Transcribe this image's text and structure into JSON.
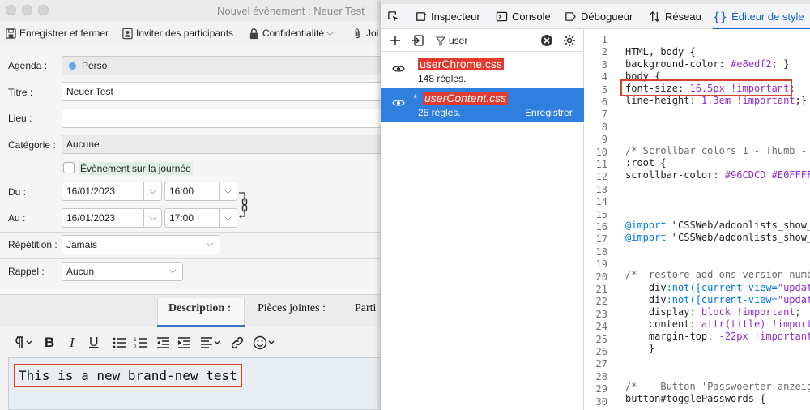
{
  "event_window": {
    "title": "Nouvel évènement : Neuer Test",
    "toolbar": {
      "save_close": "Enregistrer et fermer",
      "invite": "Inviter des participants",
      "privacy": "Confidentialité",
      "attach": "Joi"
    },
    "form": {
      "calendar_label": "Agenda :",
      "calendar_value": "Perso",
      "calendar_color": "#5fa8e8",
      "title_label": "Titre :",
      "title_value": "Neuer Test",
      "location_label": "Lieu :",
      "location_value": "",
      "category_label": "Catégorie :",
      "category_value": "Aucune",
      "allday_label": "Évènement sur la journée",
      "from_label": "Du :",
      "from_date": "16/01/2023",
      "from_time": "16:00",
      "to_label": "Au :",
      "to_date": "16/01/2023",
      "to_time": "17:00",
      "repeat_label": "Répétition :",
      "repeat_value": "Jamais",
      "reminder_label": "Rappel :",
      "reminder_value": "Aucun"
    },
    "tabs": {
      "description": "Description :",
      "attachments": "Pièces jointes :",
      "participants": "Parti"
    },
    "editor": {
      "text": "This is a new brand-new test"
    }
  },
  "devtools": {
    "tabs": {
      "inspector": "Inspecteur",
      "console": "Console",
      "debugger": "Débogueur",
      "network": "Réseau",
      "style_editor": "Éditeur de style"
    },
    "filter_value": "user",
    "sheets": [
      {
        "name": "userChrome.css",
        "rules": "148 règles."
      },
      {
        "name": "userContent.css",
        "rules": "25 règles.",
        "modified": "*",
        "save": "Enregistrer"
      }
    ],
    "code": {
      "line_numbers": [
        "1",
        "2",
        "3",
        "4",
        "5",
        "6",
        "7",
        "8",
        "9",
        "10",
        "11",
        "12",
        "13",
        "14",
        "15",
        "16",
        "17",
        "18",
        "19",
        "20",
        "21",
        "22",
        "23",
        "24",
        "25",
        "26",
        "27",
        "28",
        "29",
        "30"
      ],
      "l2_sel": "HTML, body {",
      "l3_prop": "background-color: ",
      "l3_val": "#e8edf2",
      "l3_end": "; }",
      "l4": "body {",
      "l5_prop": "font-size: ",
      "l5_val": "16.5px !important",
      "l5_end": ";",
      "l6_prop": "line-height: ",
      "l6_val": "1.3em !important",
      "l6_end": ";}",
      "l10": "/* Scrollbar colors 1 - Thumb - 2",
      "l11": ":root {",
      "l12_prop": "scrollbar-color: ",
      "l12_val": "#96CDCD #E0FFFF",
      "l12_end": ";",
      "l16_kw": "@import ",
      "l16_str": "\"CSSWeb/addonlists_show_ad",
      "l17_kw": "@import ",
      "l17_str": "\"CSSWeb/addonlists_show_ad",
      "l20": "/*  restore add-ons version number",
      "l21_a": "    div",
      "l21_b": ":not([current-view=",
      "l21_c": "\"updates",
      "l22_a": "    div",
      "l22_b": ":not([current-view=",
      "l22_c": "\"updates",
      "l23_prop": "    display: ",
      "l23_val": "block !important",
      "l23_end": ";",
      "l24_prop": "    content: ",
      "l24_val": "attr(title) !importan",
      "l25_prop": "    margin-top: ",
      "l25_val": "-22px !important",
      "l25_end": ";",
      "l26": "    }",
      "l29": "/* ---Button 'Passwoerter anzeige",
      "l30": "button#togglePasswords {"
    }
  }
}
